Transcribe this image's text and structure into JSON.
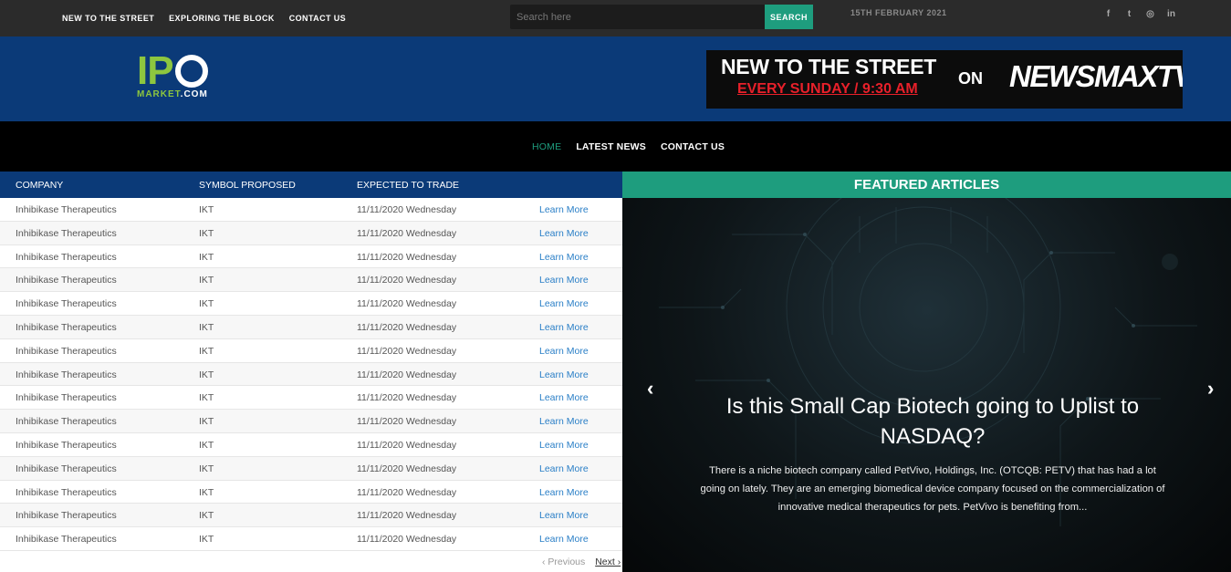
{
  "topbar": {
    "nav": [
      "NEW TO THE STREET",
      "EXPLORING THE BLOCK",
      "CONTACT US"
    ],
    "search_placeholder": "Search here",
    "search_button": "SEARCH",
    "date": "15TH FEBRUARY 2021",
    "socials": [
      {
        "icon": "facebook-icon",
        "glyph": "f"
      },
      {
        "icon": "twitter-icon",
        "glyph": "t"
      },
      {
        "icon": "instagram-icon",
        "glyph": "◎"
      },
      {
        "icon": "linkedin-icon",
        "glyph": "in"
      }
    ]
  },
  "header": {
    "logo_top": "IP",
    "logo_bottom_main": "MARKET",
    "logo_bottom_suffix": ".COM",
    "banner_line1": "NEW TO THE STREET",
    "banner_line2": "EVERY SUNDAY / 9:30 AM",
    "banner_on": "ON",
    "banner_network": "NEWSMAXTV"
  },
  "mainnav": {
    "items": [
      "HOME",
      "LATEST NEWS",
      "CONTACT US"
    ],
    "active": "HOME"
  },
  "ipo_table": {
    "columns": [
      "COMPANY",
      "SYMBOL PROPOSED",
      "EXPECTED TO TRADE"
    ],
    "rows": [
      [
        "Inhibikase Therapeutics",
        "IKT",
        "11/11/2020 Wednesday",
        "Learn More"
      ],
      [
        "Inhibikase Therapeutics",
        "IKT",
        "11/11/2020 Wednesday",
        "Learn More"
      ],
      [
        "Inhibikase Therapeutics",
        "IKT",
        "11/11/2020 Wednesday",
        "Learn More"
      ],
      [
        "Inhibikase Therapeutics",
        "IKT",
        "11/11/2020 Wednesday",
        "Learn More"
      ],
      [
        "Inhibikase Therapeutics",
        "IKT",
        "11/11/2020 Wednesday",
        "Learn More"
      ],
      [
        "Inhibikase Therapeutics",
        "IKT",
        "11/11/2020 Wednesday",
        "Learn More"
      ],
      [
        "Inhibikase Therapeutics",
        "IKT",
        "11/11/2020 Wednesday",
        "Learn More"
      ],
      [
        "Inhibikase Therapeutics",
        "IKT",
        "11/11/2020 Wednesday",
        "Learn More"
      ],
      [
        "Inhibikase Therapeutics",
        "IKT",
        "11/11/2020 Wednesday",
        "Learn More"
      ],
      [
        "Inhibikase Therapeutics",
        "IKT",
        "11/11/2020 Wednesday",
        "Learn More"
      ],
      [
        "Inhibikase Therapeutics",
        "IKT",
        "11/11/2020 Wednesday",
        "Learn More"
      ],
      [
        "Inhibikase Therapeutics",
        "IKT",
        "11/11/2020 Wednesday",
        "Learn More"
      ],
      [
        "Inhibikase Therapeutics",
        "IKT",
        "11/11/2020 Wednesday",
        "Learn More"
      ],
      [
        "Inhibikase Therapeutics",
        "IKT",
        "11/11/2020 Wednesday",
        "Learn More"
      ],
      [
        "Inhibikase Therapeutics",
        "IKT",
        "11/11/2020 Wednesday",
        "Learn More"
      ]
    ],
    "pager_prev": "‹ Previous",
    "pager_next": "Next ›"
  },
  "featured": {
    "heading": "FEATURED ARTICLES",
    "title": "Is this Small Cap Biotech going to Uplist to NASDAQ?",
    "excerpt": "There is a niche biotech company called PetVivo, Holdings, Inc. (OTCQB: PETV) that has had a lot going on lately. They are an emerging biomedical device company focused on the commercialization of innovative medical therapeutics for pets.  PetVivo is benefiting from...",
    "prev_arrow": "‹",
    "next_arrow": "›"
  },
  "colors": {
    "accent_green": "#1e9d7e",
    "brand_navy": "#0b3a78",
    "logo_lime": "#8dc63f",
    "link_blue": "#2a7fc7"
  }
}
